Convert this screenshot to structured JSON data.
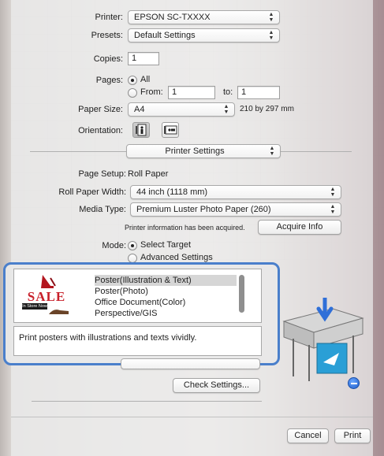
{
  "printer": {
    "label": "Printer:",
    "value": "EPSON SC-TXXXX"
  },
  "presets": {
    "label": "Presets:",
    "value": "Default Settings"
  },
  "copies": {
    "label": "Copies:",
    "value": "1"
  },
  "pages": {
    "label": "Pages:",
    "all_label": "All",
    "from_label": "From:",
    "from_value": "1",
    "to_label": "to:",
    "to_value": "1"
  },
  "paper_size": {
    "label": "Paper Size:",
    "value": "A4",
    "dims": "210 by 297 mm"
  },
  "orientation": {
    "label": "Orientation:"
  },
  "section_popup": "Printer Settings",
  "page_setup": {
    "label": "Page Setup:",
    "value": "Roll Paper"
  },
  "roll_paper_width": {
    "label": "Roll Paper Width:",
    "value": "44 inch (1118 mm)"
  },
  "media_type": {
    "label": "Media Type:",
    "value": "Premium Luster Photo Paper (260)"
  },
  "printer_info": {
    "text": "Printer information has been acquired.",
    "button": "Acquire Info"
  },
  "mode": {
    "label": "Mode:",
    "option1": "Select Target",
    "option2": "Advanced Settings"
  },
  "target_list": {
    "items": [
      "Poster(Illustration & Text)",
      "Poster(Photo)",
      "Office Document(Color)",
      "Perspective/GIS"
    ],
    "selected_index": 0,
    "thumbnail_text": "SALE",
    "thumbnail_banner": "In Store Now"
  },
  "description": "Print posters with illustrations and texts vividly.",
  "check_settings_button": "Check Settings...",
  "footer": {
    "cancel": "Cancel",
    "print": "Print"
  },
  "colors": {
    "accent_highlight": "#4a7fcb",
    "sale_red": "#c8202a"
  }
}
